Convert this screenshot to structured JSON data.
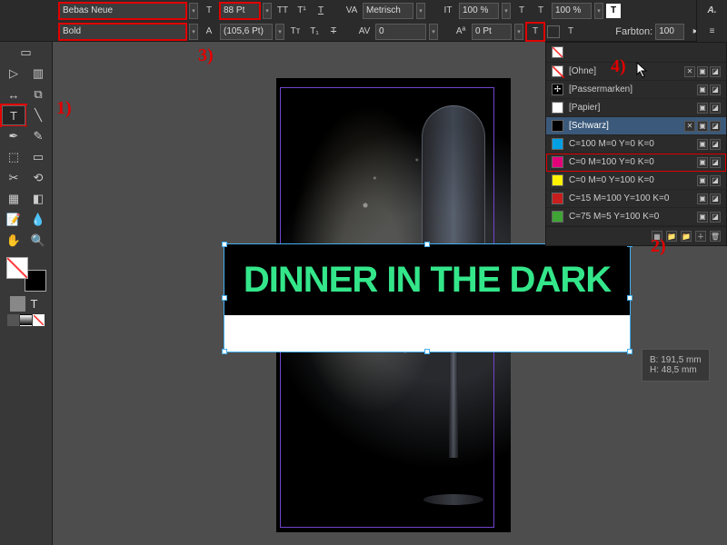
{
  "control": {
    "font": "Bebas Neue",
    "weight": "Bold",
    "size": "88 Pt",
    "leading": "(105,6 Pt)",
    "kerning_mode": "Metrisch",
    "tracking": "0",
    "hscale": "100 %",
    "vscale": "100 %",
    "tint_label": "Farbton:",
    "tint_value": "100",
    "tint_unit": "%"
  },
  "canvas": {
    "headline": "DINNER IN THE DARK"
  },
  "swatches": {
    "rows": [
      {
        "name": "[Ohne]",
        "chip": "none",
        "selected": false
      },
      {
        "name": "[Passermarken]",
        "chip": "reg",
        "selected": false
      },
      {
        "name": "[Papier]",
        "chip": "#ffffff",
        "selected": false
      },
      {
        "name": "[Schwarz]",
        "chip": "#000000",
        "selected": true
      },
      {
        "name": "C=100 M=0 Y=0 K=0",
        "chip": "#00a0e3",
        "selected": false
      },
      {
        "name": "C=0 M=100 Y=0 K=0",
        "chip": "#e2007a",
        "selected": false,
        "hl": true
      },
      {
        "name": "C=0 M=0 Y=100 K=0",
        "chip": "#fff200",
        "selected": false
      },
      {
        "name": "C=15 M=100 Y=100 K=0",
        "chip": "#c81e1e",
        "selected": false
      },
      {
        "name": "C=75 M=5 Y=100 K=0",
        "chip": "#3fa535",
        "selected": false
      }
    ]
  },
  "dim": {
    "b": "B: 191,5 mm",
    "h": "H: 48,5 mm"
  },
  "ann": {
    "a1": "1)",
    "a2": "2)",
    "a3": "3)",
    "a4": "4)"
  }
}
